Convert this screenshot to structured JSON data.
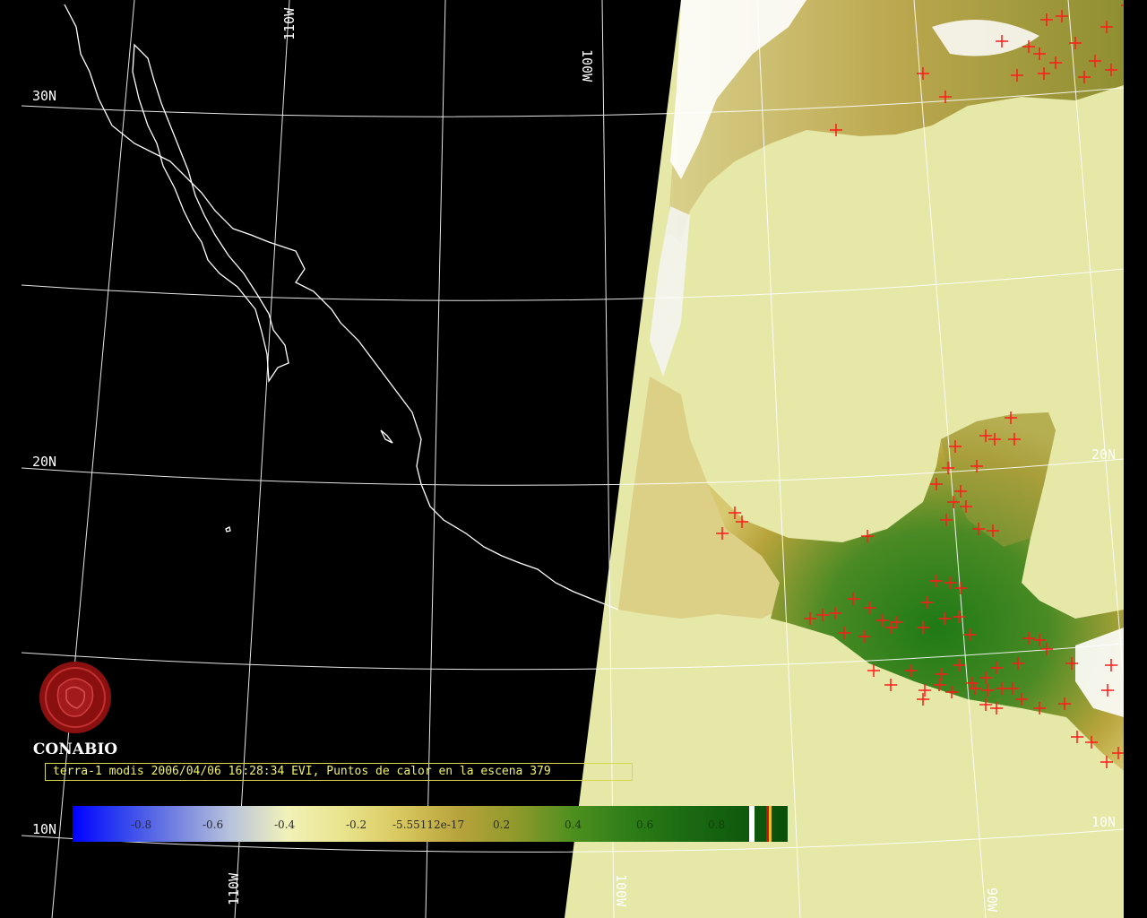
{
  "map": {
    "grid_labels": {
      "lon_110w_top": "110W",
      "lon_100w_top": "100W",
      "lat_30n": "30N",
      "lat_20n_left": "20N",
      "lat_20n_right": "20N",
      "lat_10n_left": "10N",
      "lat_10n_right": "10N",
      "lon_110w_bottom": "110W",
      "lon_100w_bottom": "100W",
      "lon_90w_bottom": "90W"
    },
    "colors": {
      "background": "#000000",
      "ocean_land_mask": "#e6e8a8",
      "coastline": "#ffffff",
      "graticule": "#ffffff",
      "hotspot": "#ff1a1a",
      "vegetation_high": "#1a7a14",
      "vegetation_mid": "#b7a33b",
      "cloud": "#ffffff"
    }
  },
  "logo": {
    "name": "CONABIO",
    "icon": "conabio-logo-icon"
  },
  "caption": "terra-1 modis 2006/04/06 16:28:34 EVI, Puntos de calor en la escena 379",
  "colorbar": {
    "labels": [
      "-0.8",
      "-0.6",
      "-0.4",
      "-0.2",
      "-5.55112e-17",
      "0.2",
      "0.4",
      "0.6",
      "0.8"
    ]
  }
}
